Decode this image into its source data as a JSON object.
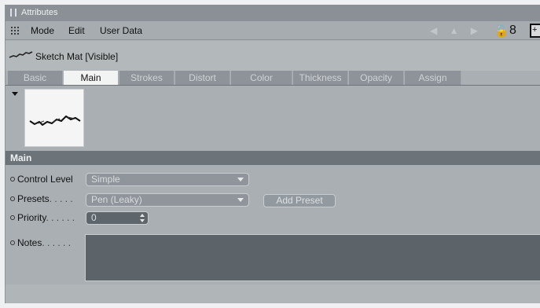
{
  "window": {
    "title": "Attributes"
  },
  "menubar": {
    "items": [
      "Mode",
      "Edit",
      "User Data"
    ],
    "lock_number": "8"
  },
  "object": {
    "name": "Sketch Mat [Visible]"
  },
  "tabs": [
    {
      "label": "Basic",
      "active": false
    },
    {
      "label": "Main",
      "active": true
    },
    {
      "label": "Strokes",
      "active": false
    },
    {
      "label": "Distort",
      "active": false
    },
    {
      "label": "Color",
      "active": false
    },
    {
      "label": "Thickness",
      "active": false
    },
    {
      "label": "Opacity",
      "active": false
    },
    {
      "label": "Assign",
      "active": false
    }
  ],
  "section": {
    "title": "Main"
  },
  "properties": {
    "control_level": {
      "label": "Control Level",
      "value": "Simple"
    },
    "presets": {
      "label": "Presets",
      "dots": ". . . . .",
      "value": "Pen (Leaky)",
      "add_button": "Add Preset"
    },
    "priority": {
      "label": "Priority",
      "dots": ". . . . . .",
      "value": "0"
    },
    "notes": {
      "label": "Notes",
      "dots": ". . . . . .",
      "value": ""
    }
  },
  "colors": {
    "accent_active_tab": "#f2f3f3",
    "section_header": "#6d7479",
    "field_bg": "#8f959a"
  }
}
